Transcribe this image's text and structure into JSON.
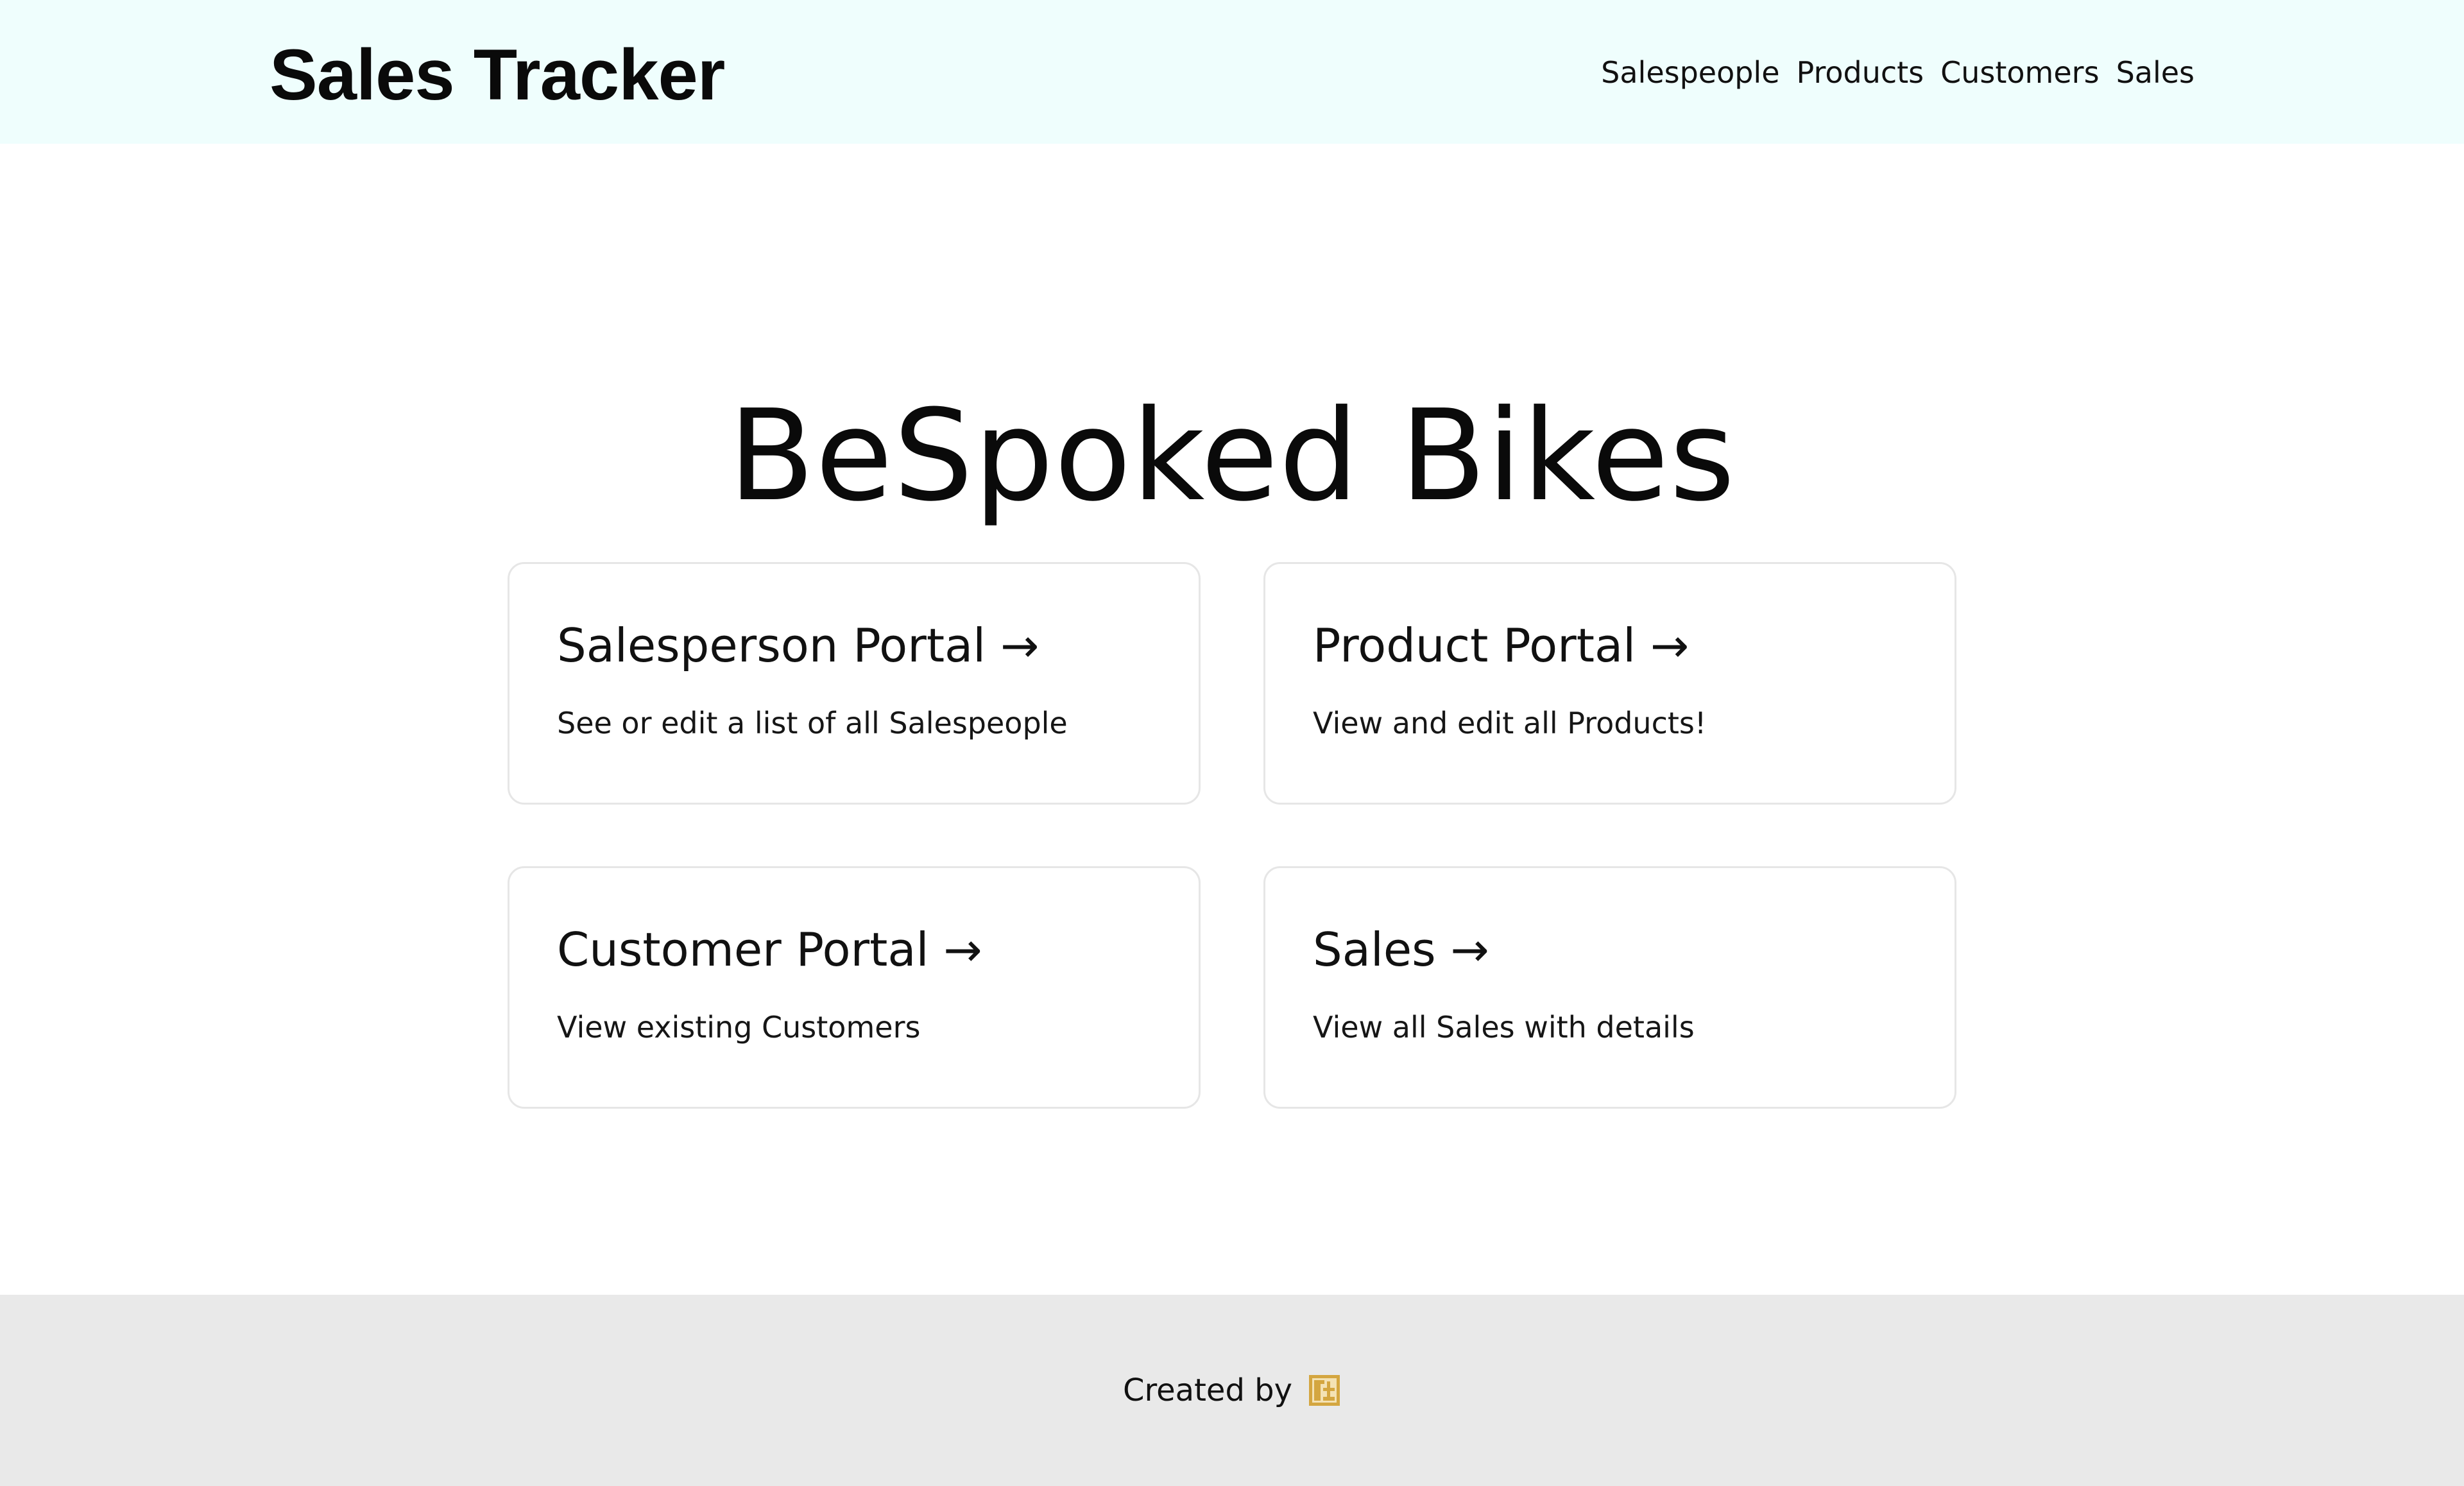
{
  "header": {
    "brand": "Sales Tracker",
    "nav": [
      {
        "label": "Salespeople"
      },
      {
        "label": "Products"
      },
      {
        "label": "Customers"
      },
      {
        "label": "Sales"
      }
    ]
  },
  "main": {
    "title": "BeSpoked Bikes",
    "cards": [
      {
        "title": "Salesperson Portal →",
        "description": "See or edit a list of all Salespeople"
      },
      {
        "title": "Product Portal →",
        "description": "View and edit all Products!"
      },
      {
        "title": "Customer Portal →",
        "description": "View existing Customers"
      },
      {
        "title": "Sales →",
        "description": "View all Sales with details"
      }
    ]
  },
  "footer": {
    "created_by": "Created by",
    "logo_icon": "creator-logo-icon",
    "logo_color": "#d4a640"
  },
  "colors": {
    "header_bg": "#effefd",
    "footer_bg": "#e9e9e9",
    "card_border": "#e6e6e6"
  }
}
